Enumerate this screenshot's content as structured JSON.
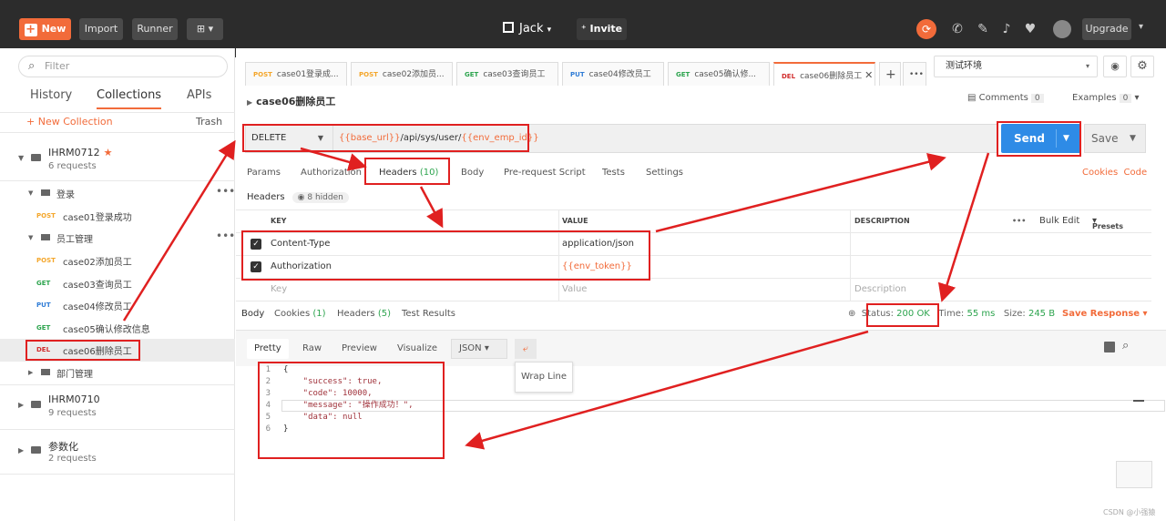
{
  "topbar": {
    "new_label": "New",
    "import_label": "Import",
    "runner_label": "Runner",
    "workspace_label": "Jack",
    "invite_label": "Invite",
    "upgrade_label": "Upgrade"
  },
  "sidebar": {
    "filter_placeholder": "Filter",
    "tabs": [
      "History",
      "Collections",
      "APIs"
    ],
    "new_collection": "+ New Collection",
    "trash": "Trash",
    "collections": [
      {
        "name": "IHRM0712",
        "count": "6 requests"
      },
      {
        "name": "IHRM0710",
        "count": "9 requests"
      },
      {
        "name": "参数化",
        "count": "2 requests"
      }
    ],
    "folder_login": "登录",
    "folder_employee": "员工管理",
    "folder_dept": "部门管理",
    "items": [
      {
        "method": "POST",
        "label": "case01登录成功"
      },
      {
        "method": "POST",
        "label": "case02添加员工"
      },
      {
        "method": "GET",
        "label": "case03查询员工"
      },
      {
        "method": "PUT",
        "label": "case04修改员工"
      },
      {
        "method": "GET",
        "label": "case05确认修改信息"
      },
      {
        "method": "DEL",
        "label": "case06删除员工"
      }
    ]
  },
  "request_tabs": [
    {
      "method": "POST",
      "label": "case01登录成..."
    },
    {
      "method": "POST",
      "label": "case02添加员..."
    },
    {
      "method": "GET",
      "label": "case03查询员工"
    },
    {
      "method": "PUT",
      "label": "case04修改员工"
    },
    {
      "method": "GET",
      "label": "case05确认修..."
    },
    {
      "method": "DEL",
      "label": "case06删除员工"
    }
  ],
  "environment": "测试环境",
  "request": {
    "title": "case06删除员工",
    "comments_label": "Comments",
    "comments_count": "0",
    "examples_label": "Examples",
    "examples_count": "0",
    "method": "DELETE",
    "url_var1": "{{base_url}}",
    "url_path": "/api/sys/user/",
    "url_var2": "{{env_emp_id}}",
    "send_label": "Send",
    "save_label": "Save"
  },
  "subtabs": {
    "params": "Params",
    "authorization": "Authorization",
    "headers": "Headers",
    "headers_count": "(10)",
    "body": "Body",
    "prerequest": "Pre-request Script",
    "tests": "Tests",
    "settings": "Settings",
    "cookies": "Cookies",
    "code": "Code"
  },
  "headers_section": {
    "title": "Headers",
    "hidden": "8 hidden",
    "col_key": "KEY",
    "col_value": "VALUE",
    "col_description": "DESCRIPTION",
    "bulk_edit": "Bulk Edit",
    "presets": "Presets",
    "rows": [
      {
        "key": "Content-Type",
        "value": "application/json"
      },
      {
        "key": "Authorization",
        "value": "{{env_token}}"
      }
    ],
    "placeholder_key": "Key",
    "placeholder_value": "Value",
    "placeholder_description": "Description"
  },
  "response": {
    "tab_body": "Body",
    "tab_cookies": "Cookies",
    "cookies_count": "(1)",
    "tab_headers": "Headers",
    "headers_count": "(5)",
    "tab_tests": "Test Results",
    "status_label": "Status:",
    "status_value": "200 OK",
    "time_label": "Time:",
    "time_value": "55 ms",
    "size_label": "Size:",
    "size_value": "245 B",
    "save_response": "Save Response",
    "view_pretty": "Pretty",
    "view_raw": "Raw",
    "view_preview": "Preview",
    "view_visualize": "Visualize",
    "format": "JSON",
    "wrap_tooltip": "Wrap Line",
    "code_lines": [
      {
        "num": "1",
        "text": "{"
      },
      {
        "num": "2",
        "text": "    \"success\": true,"
      },
      {
        "num": "3",
        "text": "    \"code\": 10000,"
      },
      {
        "num": "4",
        "text": "    \"message\": \"操作成功！\","
      },
      {
        "num": "5",
        "text": "    \"data\": null"
      },
      {
        "num": "6",
        "text": "}"
      }
    ]
  },
  "watermark": "CSDN @小强猿",
  "colors": {
    "accent": "#f26b3a",
    "send_blue": "#2e8be6",
    "annotation_red": "#e02020",
    "get_green": "#2da44e",
    "post_orange": "#f4a62a",
    "put_blue": "#2f7cd6",
    "del_red": "#d12d2d"
  }
}
